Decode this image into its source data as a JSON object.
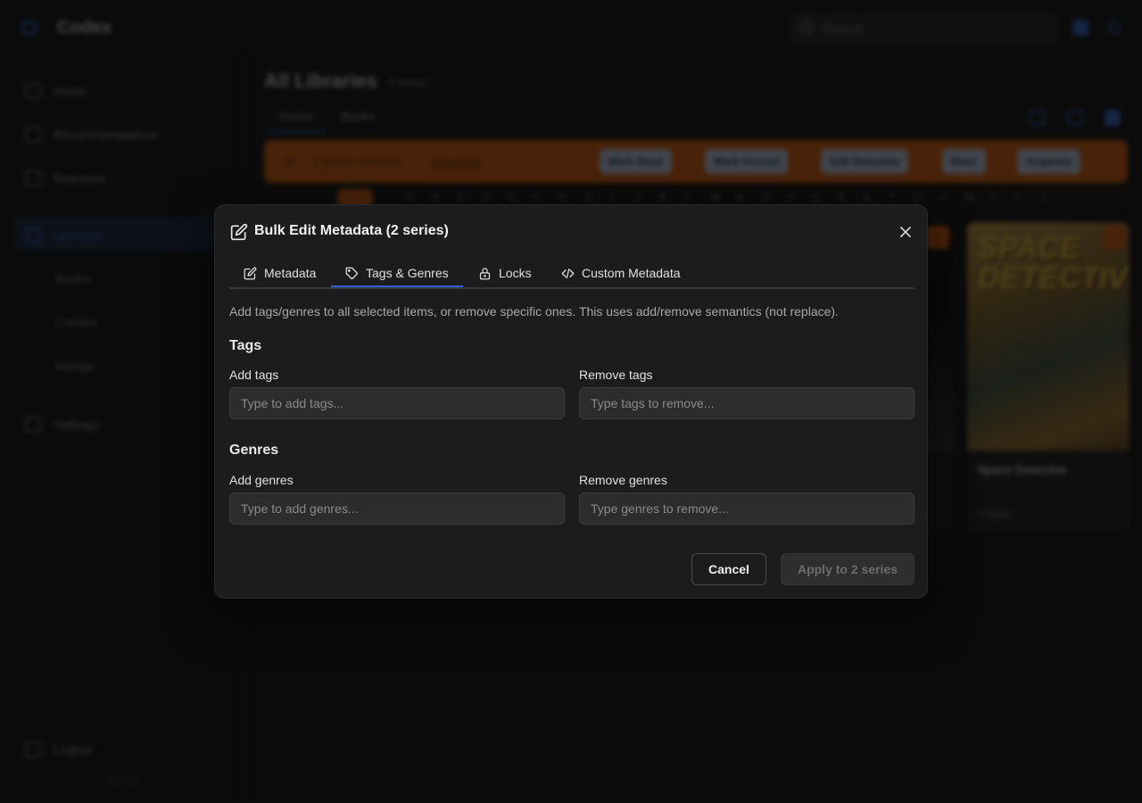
{
  "app": {
    "name": "Codex",
    "search_placeholder": "Search"
  },
  "sidebar": {
    "items": [
      {
        "label": "Home",
        "icon": "home-icon"
      },
      {
        "label": "Recommendations",
        "icon": "sparkle-icon"
      },
      {
        "label": "Releases",
        "icon": "calendar-icon"
      },
      {
        "label": "Libraries",
        "icon": "library-icon"
      },
      {
        "label": "Settings",
        "icon": "gear-icon"
      },
      {
        "label": "Logout",
        "icon": "logout-icon"
      }
    ],
    "libraries": [
      "Books",
      "Comics",
      "Manga"
    ],
    "version": "v1.0.0"
  },
  "main": {
    "title": "All Libraries",
    "count": "4 series",
    "tabs": [
      "Series",
      "Books"
    ],
    "selection_bar": {
      "selected_text": "2 series selected",
      "select_all": "Select All",
      "actions": [
        "Mark Read",
        "Mark Unread",
        "Edit Metadata",
        "More",
        "Organize"
      ]
    },
    "alphabet": [
      "A",
      "B",
      "C",
      "D",
      "E",
      "F",
      "G",
      "H",
      "I",
      "J",
      "K",
      "L",
      "M",
      "N",
      "O",
      "P",
      "Q",
      "R",
      "S",
      "T",
      "U",
      "V",
      "W",
      "X",
      "Y",
      "Z"
    ],
    "cards": [
      {
        "cover_text": "SPACE DETECTIVE",
        "title": "Space Detective",
        "subtitle": "5 books"
      }
    ]
  },
  "modal": {
    "title": "Bulk Edit Metadata (2 series)",
    "tabs": [
      {
        "label": "Metadata",
        "icon": "pencil-icon"
      },
      {
        "label": "Tags & Genres",
        "icon": "tag-icon",
        "active": true
      },
      {
        "label": "Locks",
        "icon": "lock-icon"
      },
      {
        "label": "Custom Metadata",
        "icon": "code-icon"
      }
    ],
    "description": "Add tags/genres to all selected items, or remove specific ones. This uses add/remove semantics (not replace).",
    "tags": {
      "section_title": "Tags",
      "add_label": "Add tags",
      "add_placeholder": "Type to add tags...",
      "add_value": "",
      "remove_label": "Remove tags",
      "remove_placeholder": "Type tags to remove...",
      "remove_value": ""
    },
    "genres": {
      "section_title": "Genres",
      "add_label": "Add genres",
      "add_placeholder": "Type to add genres...",
      "add_value": "",
      "remove_label": "Remove genres",
      "remove_placeholder": "Type genres to remove...",
      "remove_value": ""
    },
    "cancel_label": "Cancel",
    "apply_label": "Apply to 2 series"
  },
  "colors": {
    "accent": "#2f62d4",
    "selection_bar": "#e0620f",
    "modal_bg": "#1c1c1e"
  }
}
